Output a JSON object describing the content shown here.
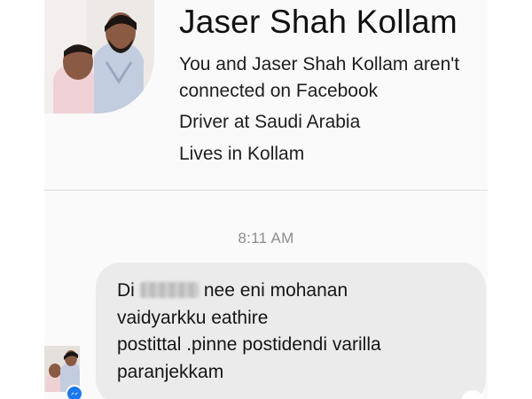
{
  "profile": {
    "name": "Jaser Shah Kollam",
    "connection_line1": "You and Jaser Shah Kollam aren't",
    "connection_line2": "connected on Facebook",
    "work": "Driver at Saudi Arabia",
    "lives": "Lives in Kollam"
  },
  "conversation": {
    "timestamp": "8:11 AM",
    "message": {
      "line1_before": "Di",
      "line1_after": "nee eni mohanan",
      "line2": "vaidyarkku eathire",
      "line3": "postittal .pinne postidendi varilla",
      "line4": "paranjekkam"
    }
  },
  "colors": {
    "messenger_blue": "#1877f2",
    "bubble_gray": "#ebebeb",
    "timestamp_gray": "#8d8d8d"
  },
  "icons": {
    "badge": "messenger-icon"
  }
}
